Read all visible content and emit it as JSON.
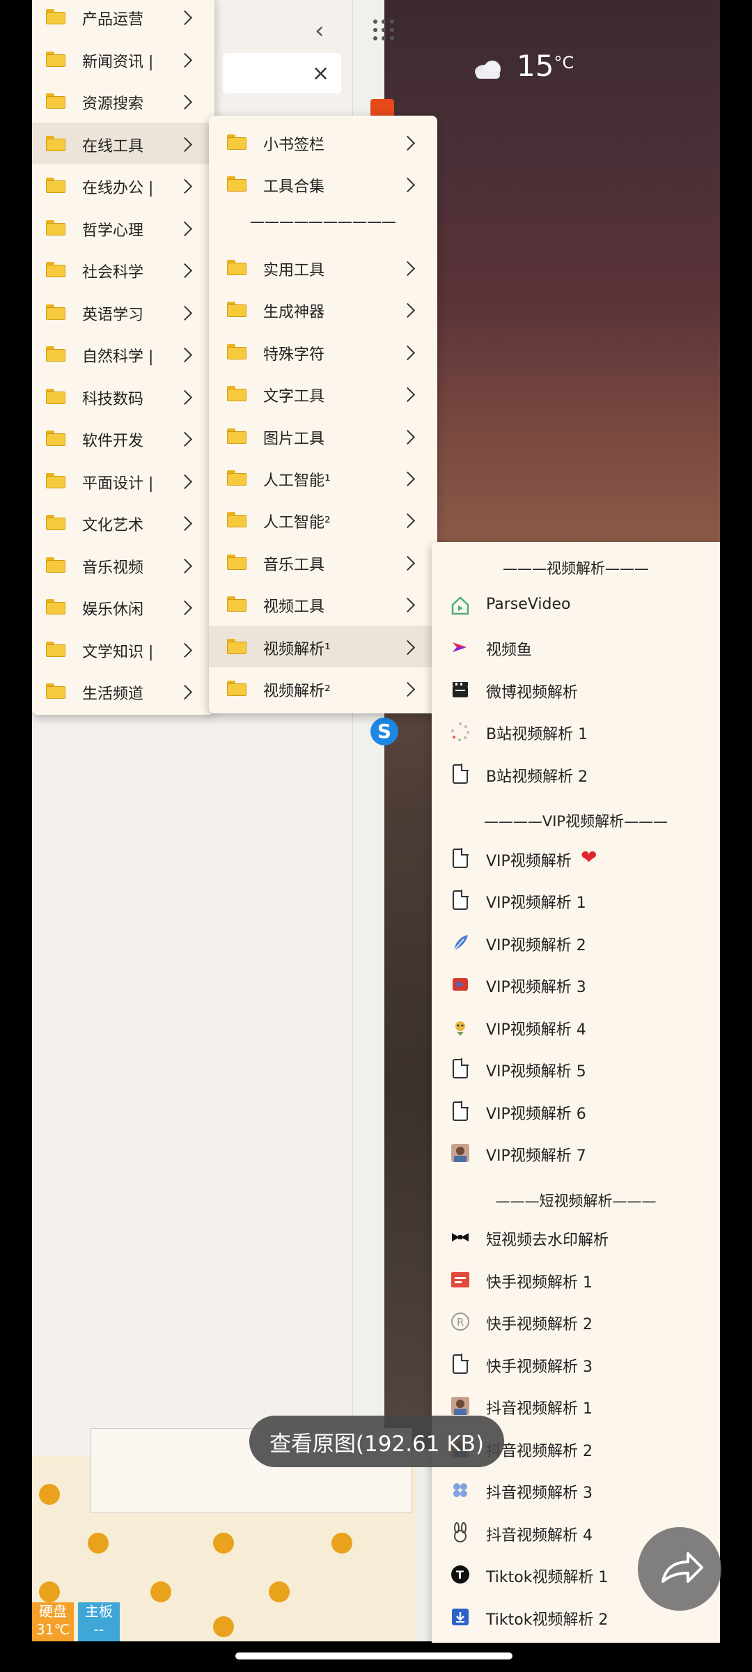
{
  "weather": {
    "temperature": "15",
    "unit": "°C"
  },
  "menu1": {
    "items": [
      "产品运营",
      "新闻资讯 |",
      "资源搜索",
      "在线工具",
      "在线办公 |",
      "哲学心理",
      "社会科学",
      "英语学习",
      "自然科学 |",
      "科技数码",
      "软件开发",
      "平面设计 |",
      "文化艺术",
      "音乐视频",
      "娱乐休闲",
      "文学知识 |",
      "生活频道"
    ],
    "selected": "在线工具"
  },
  "menu2": {
    "items_top": [
      "小书签栏",
      "工具合集"
    ],
    "separator": "——————————",
    "items": [
      "实用工具",
      "生成神器",
      "特殊字符",
      "文字工具",
      "图片工具",
      "人工智能¹",
      "人工智能²",
      "音乐工具",
      "视频工具",
      "视频解析¹",
      "视频解析²"
    ],
    "selected": "视频解析¹"
  },
  "menu3": {
    "sections": [
      {
        "header": "———视频解析———",
        "items": [
          {
            "label": "ParseVideo",
            "icon": "parsevideo-icon"
          },
          {
            "label": "视频鱼",
            "icon": "videofish-icon"
          },
          {
            "label": "微博视频解析",
            "icon": "clapper-icon"
          },
          {
            "label": "B站视频解析 1",
            "icon": "loading-icon"
          },
          {
            "label": "B站视频解析 2",
            "icon": "doc-icon"
          }
        ]
      },
      {
        "header": "————VIP视频解析———",
        "items": [
          {
            "label": "VIP视频解析",
            "icon": "doc-icon",
            "badge": "heart"
          },
          {
            "label": "VIP视频解析 1",
            "icon": "doc-icon"
          },
          {
            "label": "VIP视频解析 2",
            "icon": "feather-icon"
          },
          {
            "label": "VIP视频解析 3",
            "icon": "red-flag-icon"
          },
          {
            "label": "VIP视频解析 4",
            "icon": "sprite-icon"
          },
          {
            "label": "VIP视频解析 5",
            "icon": "doc-icon"
          },
          {
            "label": "VIP视频解析 6",
            "icon": "doc-icon"
          },
          {
            "label": "VIP视频解析 7",
            "icon": "avatar-icon"
          }
        ]
      },
      {
        "header": "———短视频解析———",
        "items": [
          {
            "label": "短视频去水印解析",
            "icon": "bowtie-icon"
          },
          {
            "label": "快手视频解析 1",
            "icon": "red-square-icon"
          },
          {
            "label": "快手视频解析 2",
            "icon": "circle-r-icon"
          },
          {
            "label": "快手视频解析 3",
            "icon": "doc-icon"
          },
          {
            "label": "抖音视频解析 1",
            "icon": "avatar-icon"
          },
          {
            "label": "抖音视频解析 2",
            "icon": "avatar-icon"
          },
          {
            "label": "抖音视频解析 3",
            "icon": "clover-icon"
          },
          {
            "label": "抖音视频解析 4",
            "icon": "rabbit-icon"
          },
          {
            "label": "Tiktok视频解析 1",
            "icon": "tiktok-icon"
          },
          {
            "label": "Tiktok视频解析 2",
            "icon": "download-icon"
          }
        ]
      }
    ]
  },
  "taskbar": {
    "tile1_label": "硬盘",
    "tile1_value": "31℃",
    "tile2_label": "主板",
    "tile2_value": "--"
  },
  "toast": {
    "text": "查看原图(192.61 KB)"
  },
  "colors": {
    "folder": "#f7c93c",
    "menu_bg": "#fdf6ec",
    "selected_bg": "#ece4d8"
  }
}
